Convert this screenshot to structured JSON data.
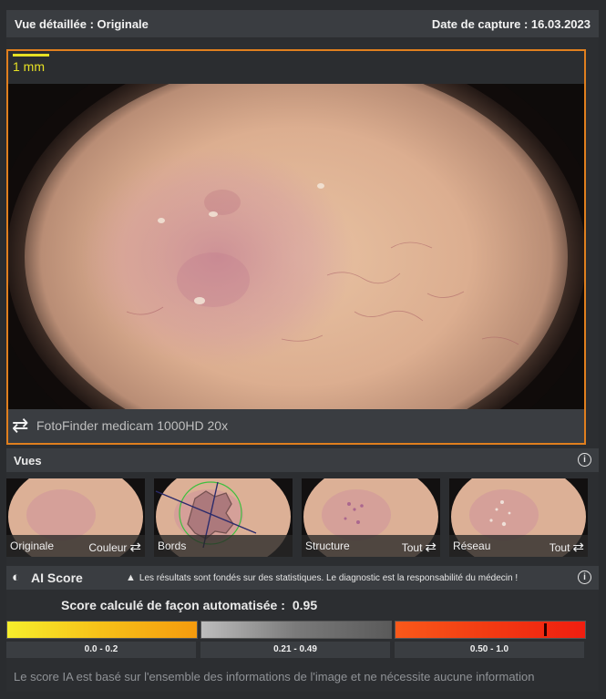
{
  "header": {
    "view_title": "Vue détaillée : Originale",
    "capture_date": "Date de capture : 16.03.2023"
  },
  "viewer": {
    "scale_label": "1 mm",
    "device_label": "FotoFinder medicam 1000HD 20x",
    "refresh_icon": "refresh-arrows-icon",
    "frame_color": "#e07f1e",
    "scale_color": "#e6e024"
  },
  "views": {
    "title": "Vues",
    "info_icon": "info-icon",
    "thumbnails": [
      {
        "left": "Originale",
        "right": "Couleur"
      },
      {
        "left": "Bords",
        "right": ""
      },
      {
        "left": "Structure",
        "right": "Tout"
      },
      {
        "left": "Réseau",
        "right": "Tout"
      }
    ]
  },
  "ai_score": {
    "title": "AI Score",
    "warning": "Les résultats sont fondés sur des statistiques. Le diagnostic est la responsabilité du médecin !",
    "score_label": "Score calculé de façon automatisée :",
    "score_value": "0.95",
    "score": 0.95,
    "ranges": [
      "0.0 - 0.2",
      "0.21 - 0.49",
      "0.50 - 1.0"
    ],
    "note": "Le score IA est basé sur l'ensemble des informations de l'image et ne nécessite aucune information"
  }
}
